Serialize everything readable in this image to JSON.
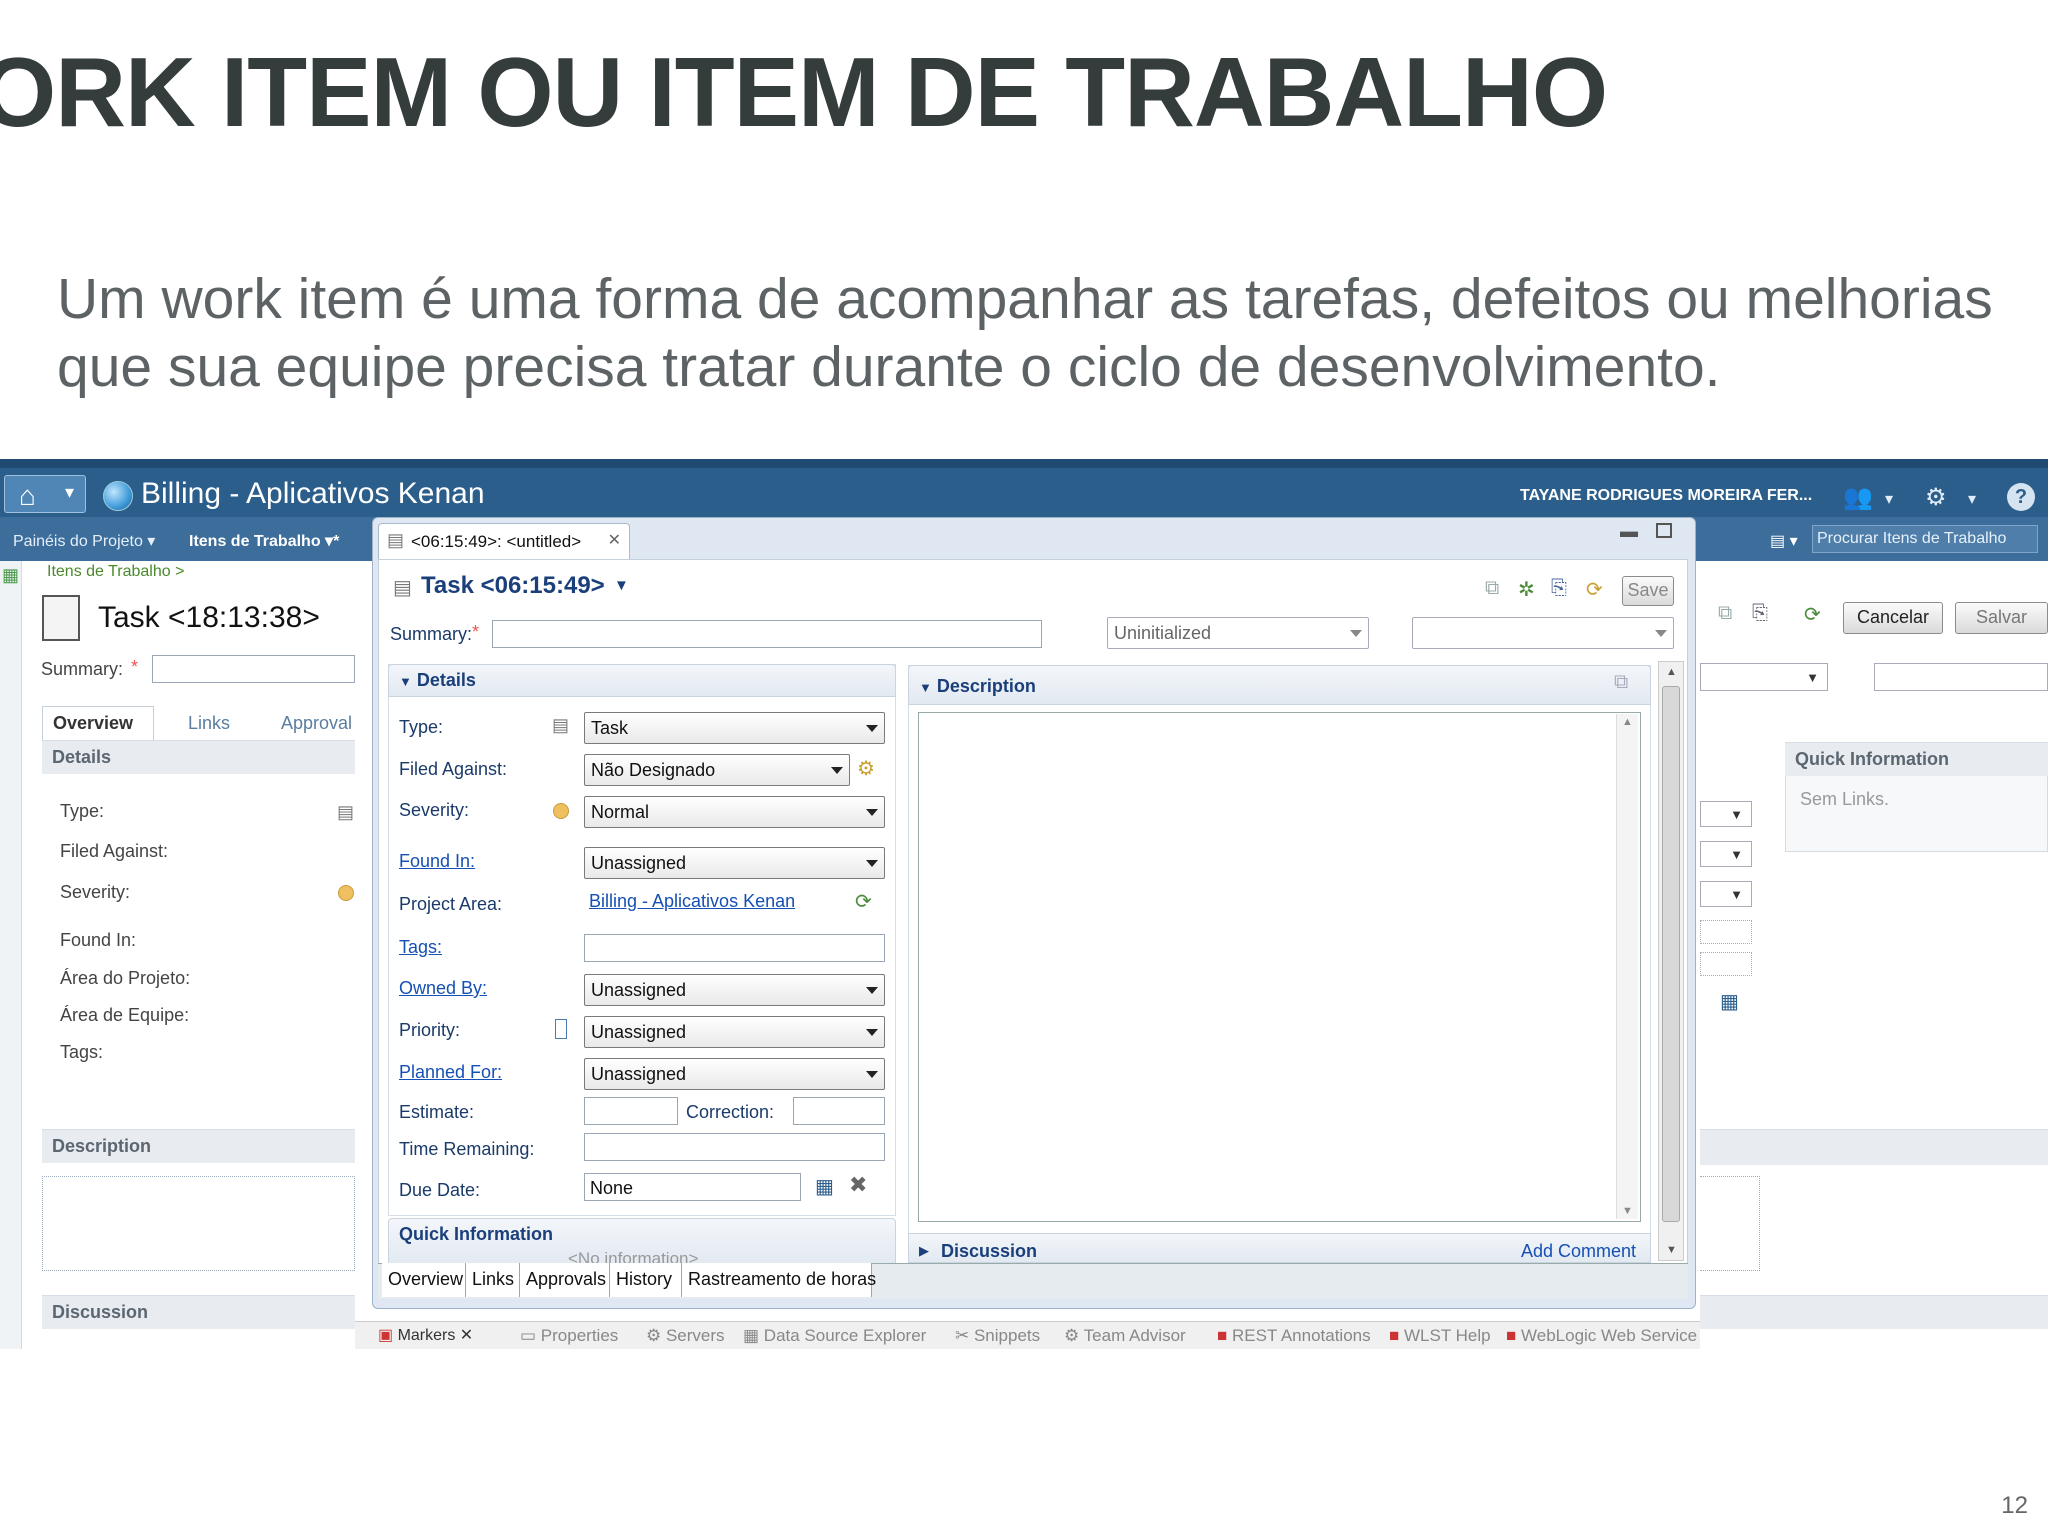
{
  "slide": {
    "title": "ORK ITEM OU ITEM DE TRABALHO",
    "subtitle_line1": "Um work item é uma forma de acompanhar as tarefas, defeitos ou melhorias",
    "subtitle_line2": "que sua equipe precisa tratar durante o ciclo de desenvolvimento.",
    "page_number": "12"
  },
  "app": {
    "project": "Billing - Aplicativos Kenan",
    "user": "TAYANE RODRIGUES MOREIRA FER...",
    "nav_projects": "Painéis do Projeto",
    "nav_work_items": "Itens de Trabalho",
    "search_placeholder": "Procurar Itens de Trabalho"
  },
  "background_editor": {
    "breadcrumb": "Itens de Trabalho >",
    "task_title": "Task <18:13:38>",
    "summary_label": "Summary:",
    "required_mark": "*",
    "tabs": [
      "Overview",
      "Links",
      "Approval"
    ],
    "details_header": "Details",
    "fields": [
      "Type:",
      "Filed Against:",
      "Severity:",
      "Found In:",
      "Área do Projeto:",
      "Área de Equipe:",
      "Tags:"
    ],
    "description_header": "Description",
    "discussion_header": "Discussion",
    "cancel_button": "Cancelar",
    "save_button": "Salvar",
    "quick_info_header": "Quick Information",
    "quick_info_text": "Sem Links."
  },
  "dialog": {
    "tab_title": "<06:15:49>: <untitled>",
    "task_title": "Task <06:15:49>",
    "save_button": "Save",
    "summary_label": "Summary:",
    "required_mark": "*",
    "state_value": "Uninitialized",
    "details_header": "Details",
    "type_label": "Type:",
    "type_value": "Task",
    "filed_against_label": "Filed Against:",
    "filed_against_value": "Não Designado",
    "severity_label": "Severity:",
    "severity_value": "Normal",
    "found_in_label": "Found In:",
    "found_in_value": "Unassigned",
    "project_area_label": "Project Area:",
    "project_area_value": "Billing - Aplicativos Kenan",
    "tags_label": "Tags:",
    "owned_by_label": "Owned By:",
    "owned_by_value": "Unassigned",
    "priority_label": "Priority:",
    "priority_value": "Unassigned",
    "planned_for_label": "Planned For:",
    "planned_for_value": "Unassigned",
    "estimate_label": "Estimate:",
    "correction_label": "Correction:",
    "time_remaining_label": "Time Remaining:",
    "due_date_label": "Due Date:",
    "due_date_value": "None",
    "description_header": "Description",
    "quick_info_header": "Quick Information",
    "quick_info_text": "<No information>",
    "discussion_header": "Discussion",
    "add_comment": "Add Comment",
    "bottom_tabs": [
      "Overview",
      "Links",
      "Approvals",
      "History",
      "Rastreamento de horas"
    ]
  },
  "bottom_views": [
    "Markers",
    "Properties",
    "Servers",
    "Data Source Explorer",
    "Snippets",
    "Team Advisor",
    "REST Annotations",
    "WLST Help",
    "WebLogic Web Service"
  ]
}
